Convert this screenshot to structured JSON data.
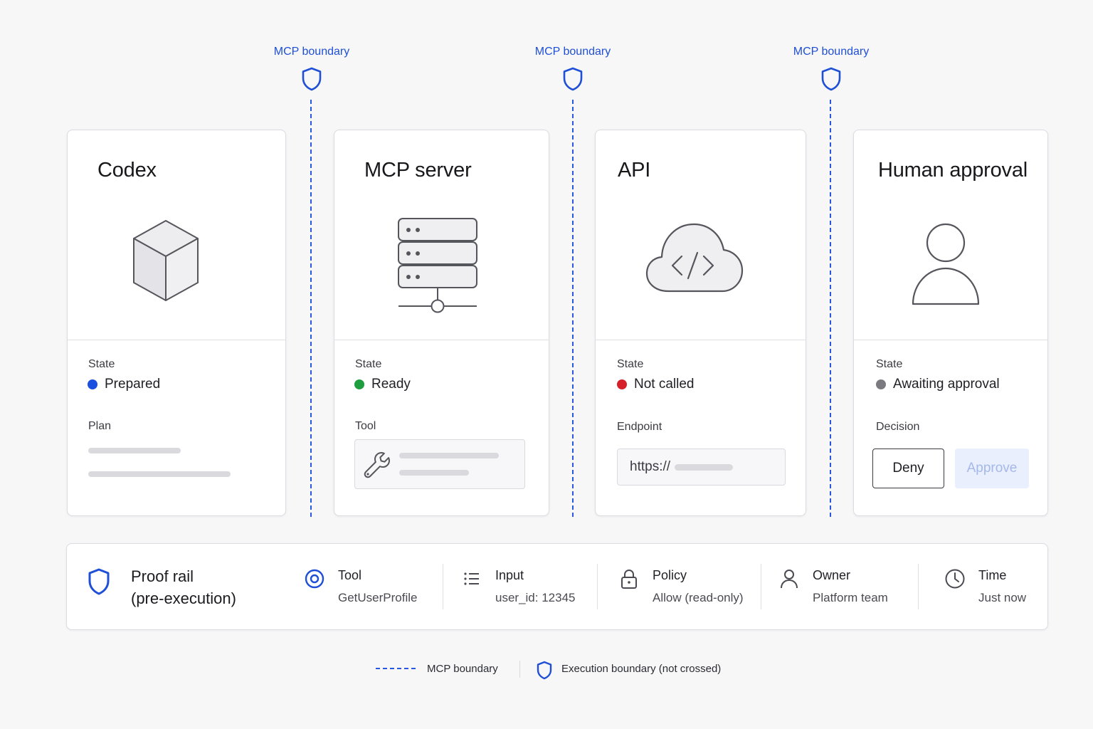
{
  "boundaries": [
    {
      "label": "MCP boundary"
    },
    {
      "label": "MCP boundary"
    },
    {
      "label": "MCP boundary"
    }
  ],
  "cards": {
    "codex": {
      "title": "Codex",
      "icon": "cube-icon",
      "state_label": "State",
      "state_value": "Prepared",
      "state_color": "#1a4fe0",
      "section_label": "Plan"
    },
    "mcp_server": {
      "title": "MCP server",
      "icon": "server-icon",
      "state_label": "State",
      "state_value": "Ready",
      "state_color": "#1e9e3e",
      "section_label": "Tool"
    },
    "api": {
      "title": "API",
      "icon": "cloud-code-icon",
      "state_label": "State",
      "state_value": "Not called",
      "state_color": "#d6202a",
      "section_label": "Endpoint",
      "endpoint_prefix": "https://"
    },
    "human_approval": {
      "title": "Human approval",
      "icon": "user-icon",
      "state_label": "State",
      "state_value": "Awaiting approval",
      "state_color": "#7a7a80",
      "section_label": "Decision",
      "deny_label": "Deny",
      "approve_label": "Approve"
    }
  },
  "proof_rail": {
    "title_line1": "Proof rail",
    "title_line2": "(pre-execution)",
    "items": [
      {
        "label": "Tool",
        "value": "GetUserProfile",
        "icon": "target-icon"
      },
      {
        "label": "Input",
        "value": "user_id: 12345",
        "icon": "list-icon"
      },
      {
        "label": "Policy",
        "value": "Allow (read-only)",
        "icon": "lock-icon"
      },
      {
        "label": "Owner",
        "value": "Platform team",
        "icon": "person-icon"
      },
      {
        "label": "Time",
        "value": "Just now",
        "icon": "clock-icon"
      }
    ]
  },
  "legend": {
    "dashed_label": "MCP boundary",
    "shield_label": "Execution boundary (not crossed)"
  },
  "colors": {
    "accent": "#1f4fd6",
    "boundary_line": "#2a56e0"
  }
}
